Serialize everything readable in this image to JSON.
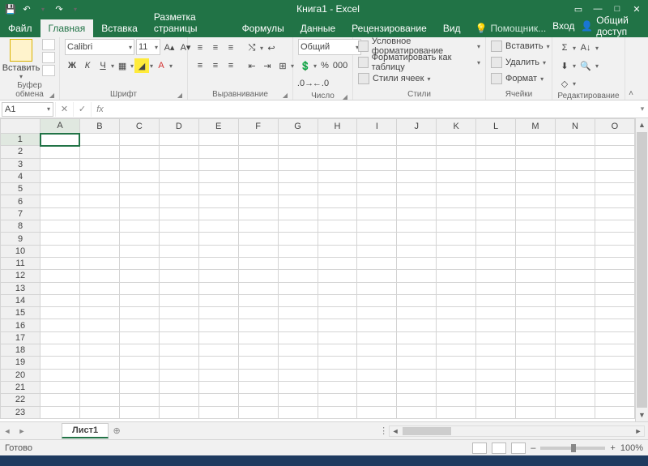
{
  "title": "Книга1 - Excel",
  "qat": {
    "save": "💾",
    "undo": "↶",
    "redo": "↷"
  },
  "tabs": {
    "file": "Файл",
    "items": [
      "Главная",
      "Вставка",
      "Разметка страницы",
      "Формулы",
      "Данные",
      "Рецензирование",
      "Вид"
    ],
    "active": 0,
    "tell": "Помощник...",
    "signin": "Вход",
    "share": "Общий доступ"
  },
  "ribbon": {
    "clipboard": {
      "paste": "Вставить",
      "label": "Буфер обмена"
    },
    "font": {
      "name": "Calibri",
      "size": "11",
      "bold": "Ж",
      "italic": "К",
      "underline": "Ч",
      "label": "Шрифт"
    },
    "align": {
      "label": "Выравнивание"
    },
    "number": {
      "format": "Общий",
      "label": "Число"
    },
    "styles": {
      "cond": "Условное форматирование",
      "table": "Форматировать как таблицу",
      "cell": "Стили ячеек",
      "label": "Стили"
    },
    "cells": {
      "insert": "Вставить",
      "delete": "Удалить",
      "format": "Формат",
      "label": "Ячейки"
    },
    "editing": {
      "label": "Редактирование"
    }
  },
  "namebox": "A1",
  "fx": "fx",
  "columns": [
    "A",
    "B",
    "C",
    "D",
    "E",
    "F",
    "G",
    "H",
    "I",
    "J",
    "K",
    "L",
    "M",
    "N",
    "O"
  ],
  "rows": [
    1,
    2,
    3,
    4,
    5,
    6,
    7,
    8,
    9,
    10,
    11,
    12,
    13,
    14,
    15,
    16,
    17,
    18,
    19,
    20,
    21,
    22,
    23
  ],
  "sheet": "Лист1",
  "status": {
    "ready": "Готово",
    "zoom": "100%"
  }
}
